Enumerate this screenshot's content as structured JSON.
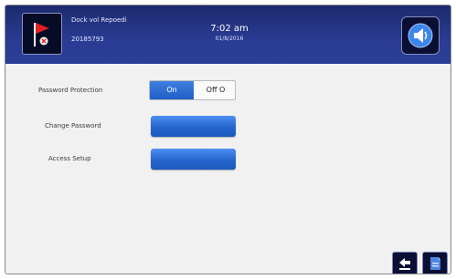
{
  "header": {
    "site_name": "Dock vol Repoedi",
    "site_id": "20185793",
    "time": "7:02 am",
    "date": "01/8/2016",
    "flag_icon": "red-flag-icon",
    "speaker_icon": "speaker-icon"
  },
  "settings": {
    "password_protection": {
      "label": "Password Protection",
      "on_label": "On",
      "off_label": "Off O",
      "selected": "On"
    },
    "change_password": {
      "label": "Change Password"
    },
    "access_setup": {
      "label": "Access Setup"
    }
  },
  "footer": {
    "back_icon": "back-arrow-icon",
    "bookmark_icon": "bookmark-icon"
  },
  "colors": {
    "header_bg": "#2a3c93",
    "button_blue": "#2465cf",
    "flag_red": "#e02020"
  }
}
